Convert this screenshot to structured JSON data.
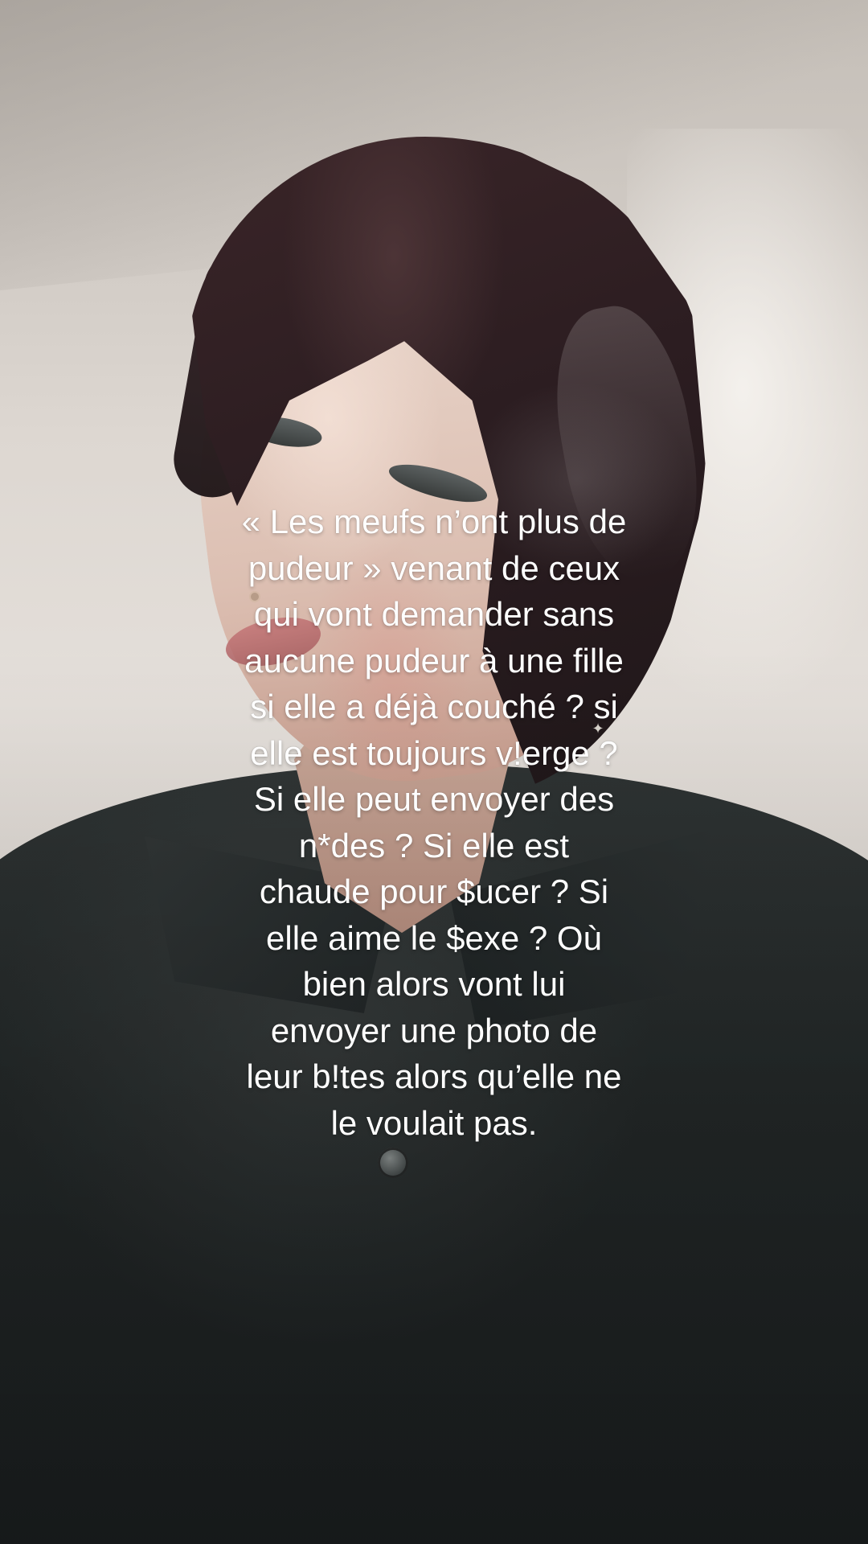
{
  "caption": {
    "text": "« Les meufs n’ont plus de\npudeur » venant de ceux\nqui vont demander sans\naucune pudeur à une fille\nsi elle a déjà couché ? si\nelle est toujours v!erge ?\nSi elle peut envoyer des\nn*des ? Si elle est\nchaude pour $ucer ? Si\nelle aime le $exe ? Où\nbien alors vont lui\nenvoyer une photo de\nleur b!tes alors qu’elle ne\nle voulait pas."
  }
}
